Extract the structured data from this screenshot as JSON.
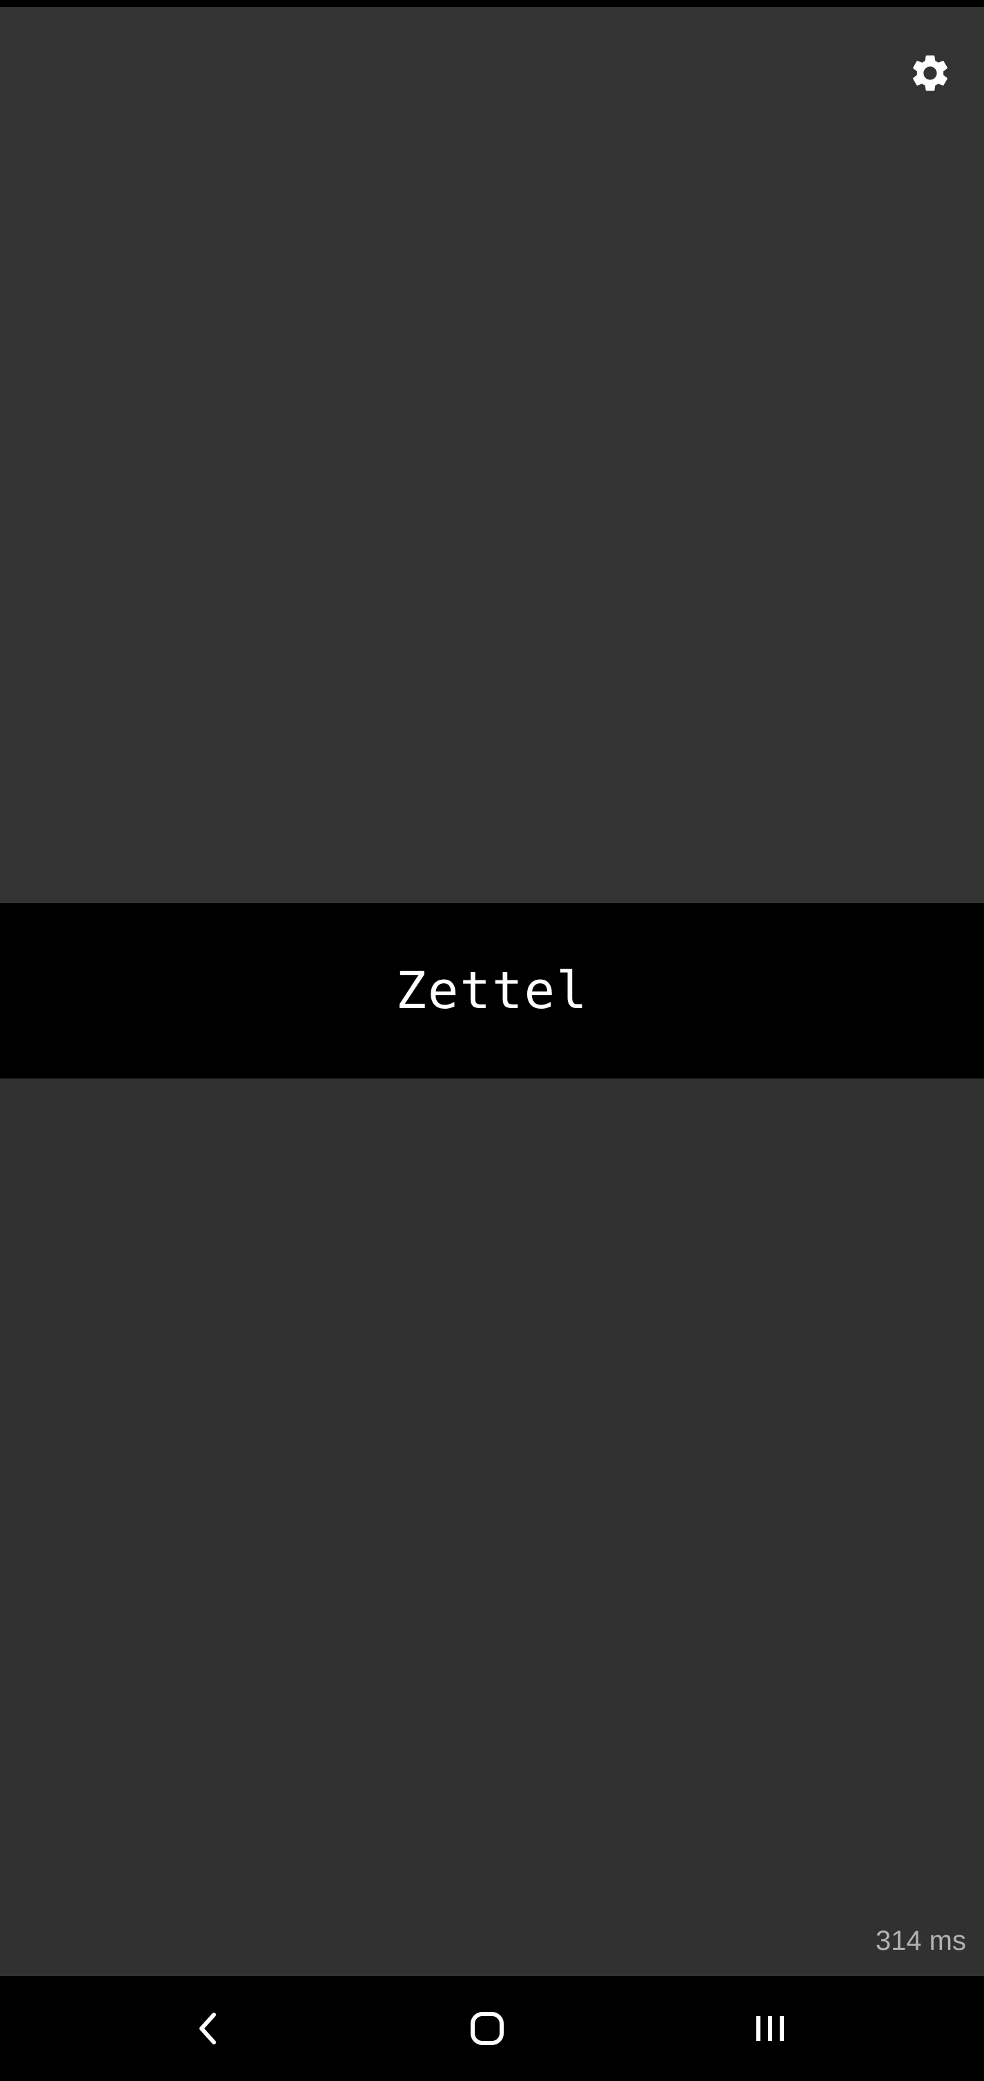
{
  "app": {
    "title": "Zettel",
    "timing": "314 ms"
  },
  "icons": {
    "settings": "gear-icon",
    "back": "chevron-left-icon",
    "home": "rounded-square-icon",
    "recents": "three-bars-icon"
  },
  "colors": {
    "panel": "#333333",
    "title_bar": "#000000",
    "text": "#ffffff",
    "muted_text": "#b3b3b3"
  }
}
